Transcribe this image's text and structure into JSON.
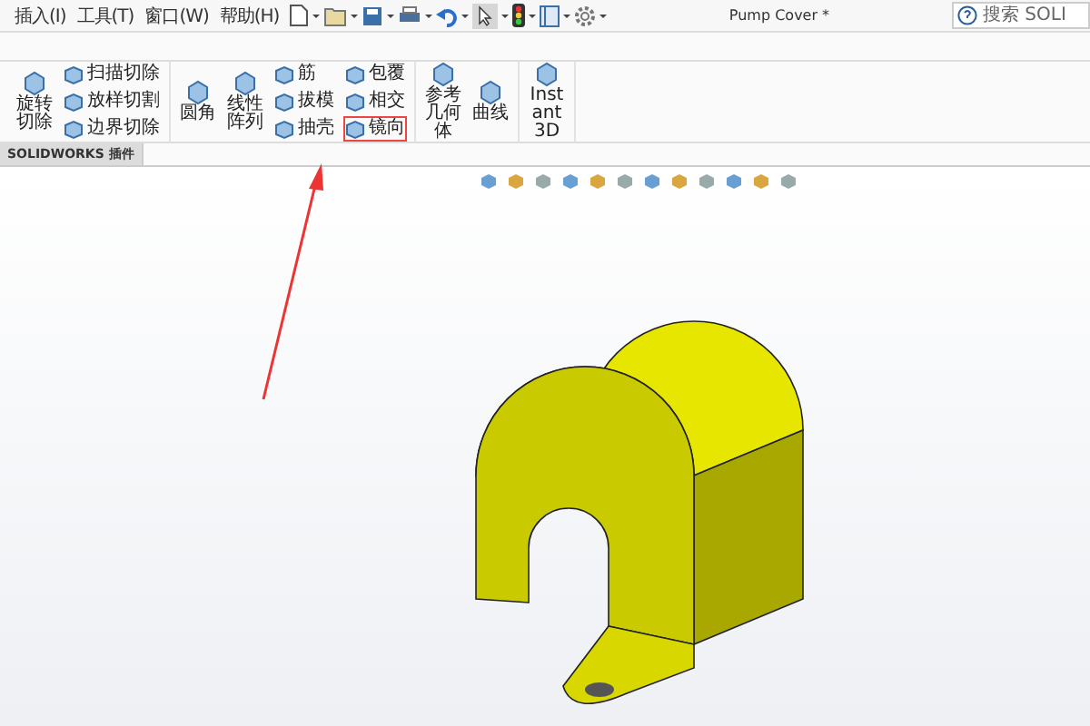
{
  "menu": [
    {
      "label": "插入(I)"
    },
    {
      "label": "工具(T)"
    },
    {
      "label": "窗口(W)"
    },
    {
      "label": "帮助(H)"
    }
  ],
  "title": "Pump Cover *",
  "search": {
    "placeholder": "搜索 SOLI"
  },
  "ribbon": {
    "groups": [
      {
        "items": [
          {
            "kind": "large",
            "label": "旋转切除"
          },
          {
            "kind": "column",
            "items": [
              {
                "label": "扫描切除",
                "highlighted": false
              },
              {
                "label": "放样切割",
                "highlighted": false
              },
              {
                "label": "边界切除",
                "highlighted": false
              }
            ]
          }
        ]
      },
      {
        "items": [
          {
            "kind": "large",
            "label": "圆角"
          },
          {
            "kind": "large",
            "label": "线性阵列"
          },
          {
            "kind": "column",
            "items": [
              {
                "label": "筋",
                "highlighted": false
              },
              {
                "label": "拔模",
                "highlighted": false
              },
              {
                "label": "抽壳",
                "highlighted": false
              }
            ]
          },
          {
            "kind": "column",
            "items": [
              {
                "label": "包覆",
                "highlighted": false
              },
              {
                "label": "相交",
                "highlighted": false
              },
              {
                "label": "镜向",
                "highlighted": true
              }
            ]
          }
        ]
      },
      {
        "items": [
          {
            "kind": "large",
            "label": "参考几何体"
          },
          {
            "kind": "large",
            "label": "曲线"
          }
        ]
      },
      {
        "items": [
          {
            "kind": "large",
            "label": "Instant3D"
          }
        ]
      }
    ]
  },
  "tabs": [
    {
      "label": "SOLIDWORKS 插件",
      "selected": true
    }
  ]
}
